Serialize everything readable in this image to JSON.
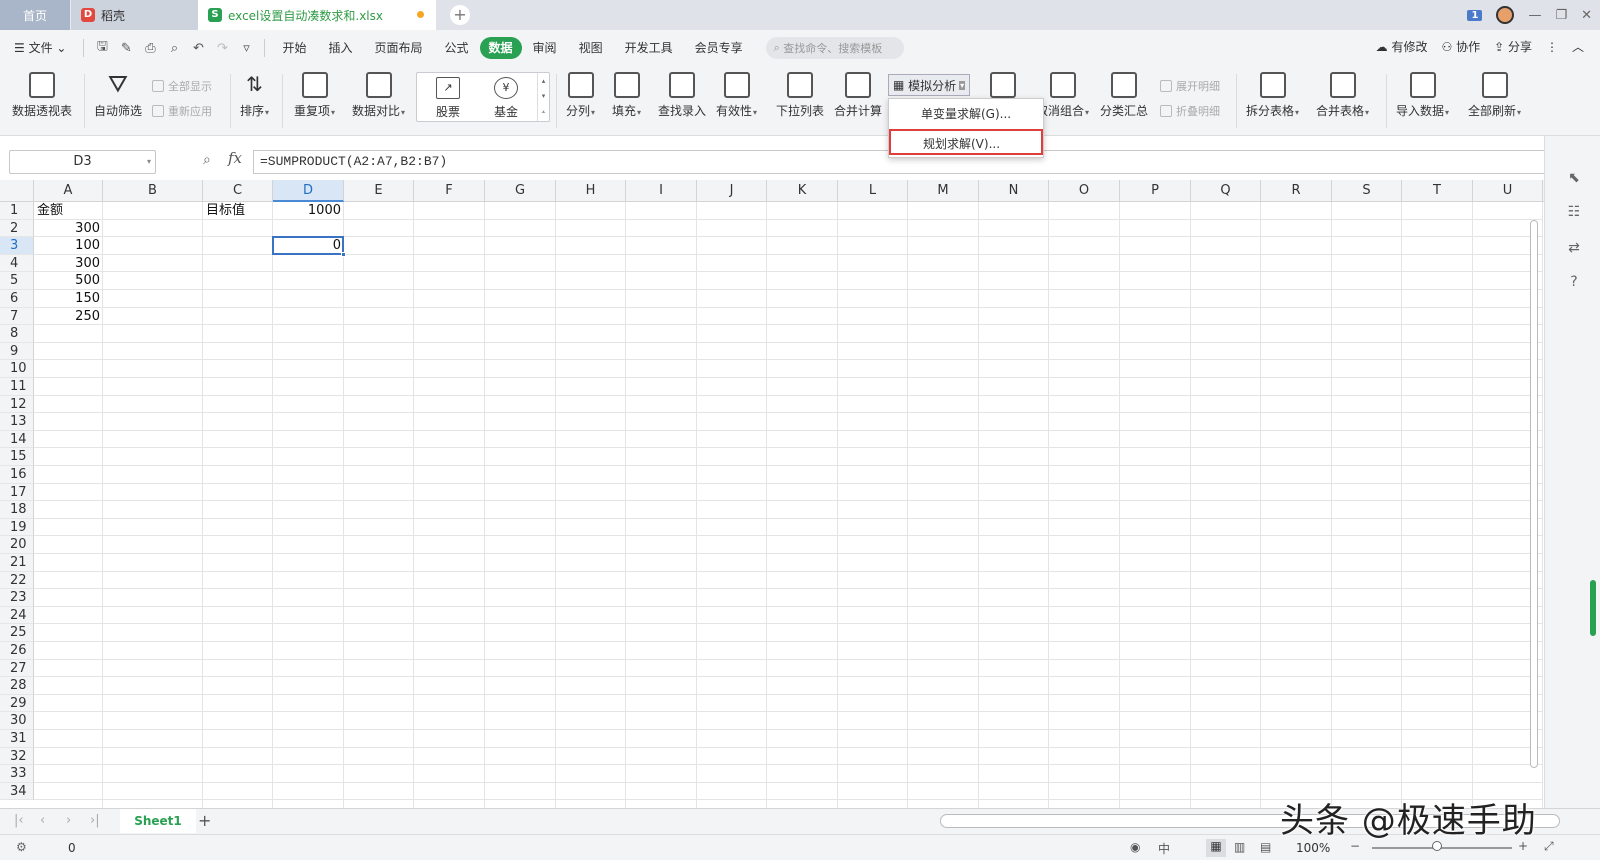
{
  "tabs": {
    "home": "首页",
    "daoke": "稻壳",
    "doc": "excel设置自动凑数求和.xlsx"
  },
  "window": {
    "badge": "1"
  },
  "menu": {
    "file": "文件",
    "items": [
      "开始",
      "插入",
      "页面布局",
      "公式",
      "数据",
      "审阅",
      "视图",
      "开发工具",
      "会员专享"
    ],
    "active": "数据",
    "search_placeholder": "查找命令、搜索模板",
    "right": {
      "modify": "有修改",
      "collab": "协作",
      "share": "分享"
    }
  },
  "ribbon": {
    "pivot": "数据透视表",
    "autofilter": "自动筛选",
    "showall": "全部显示",
    "reapply": "重新应用",
    "sort": "排序",
    "dup": "重复项",
    "compare": "数据对比",
    "stock": "股票",
    "fund": "基金",
    "split": "分列",
    "fill": "填充",
    "lookup": "查找录入",
    "validity": "有效性",
    "dropdown": "下拉列表",
    "consolidate": "合并计算",
    "simulate": "模拟分析",
    "ungroup": "取消组合",
    "subtotal": "分类汇总",
    "expand": "展开明细",
    "collapse": "折叠明细",
    "splittable": "拆分表格",
    "mergetable": "合并表格",
    "import": "导入数据",
    "refresh": "全部刷新"
  },
  "dropdown_menu": {
    "item1": "单变量求解(G)...",
    "item2": "规划求解(V)..."
  },
  "formula_bar": {
    "name_box": "D3",
    "fx": "fx",
    "formula": "=SUMPRODUCT(A2:A7,B2:B7)"
  },
  "columns": [
    "A",
    "B",
    "C",
    "D",
    "E",
    "F",
    "G",
    "H",
    "I",
    "J",
    "K",
    "L",
    "M",
    "N",
    "O",
    "P",
    "Q",
    "R",
    "S",
    "T",
    "U"
  ],
  "selected_column": "D",
  "rows": [
    "1",
    "2",
    "3",
    "4",
    "5",
    "6",
    "7",
    "8",
    "9",
    "10",
    "11",
    "12",
    "13",
    "14",
    "15",
    "16",
    "17",
    "18",
    "19",
    "20",
    "21",
    "22",
    "23",
    "24",
    "25",
    "26",
    "27",
    "28",
    "29",
    "30",
    "31",
    "32",
    "33",
    "34"
  ],
  "selected_row": "3",
  "cells": {
    "A1": "金额",
    "A2": "300",
    "A3": "100",
    "A4": "300",
    "A5": "500",
    "A6": "150",
    "A7": "250",
    "C1": "目标值",
    "D1": "1000",
    "D3": "0"
  },
  "sheet": {
    "name": "Sheet1"
  },
  "status": {
    "value": "0",
    "zoom": "100%"
  },
  "watermark": "头条 @极速手助"
}
